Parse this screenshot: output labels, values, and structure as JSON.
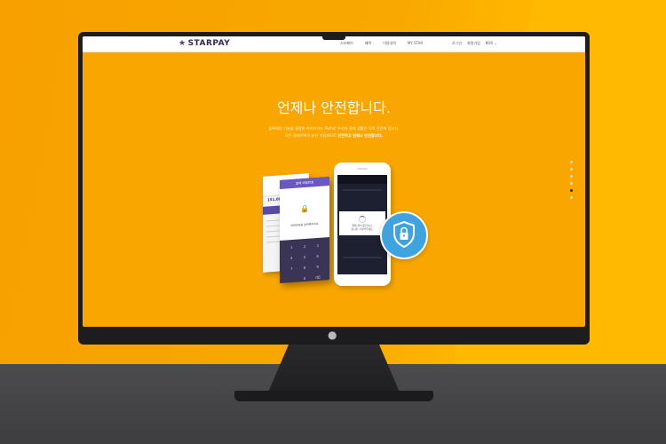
{
  "brand": {
    "name": "STARPAY"
  },
  "nav": {
    "menu": [
      "스타페이",
      "혜택",
      "이용내역",
      "MY STAR"
    ],
    "right": [
      "로그인",
      "회원가입",
      "KOR ⌄"
    ]
  },
  "hero": {
    "title": "언제나 안전합니다.",
    "desc_line1": "블록체인 기술을 결합한 하이브리드 Tech로 우리의 결제 생활은 더욱 안전해 집니다.",
    "desc_line2_plain": "모든 결제기록이 분산 저장되므로",
    "desc_line2_bold": "안전하고 언제나 안전합니다."
  },
  "phone_popup": {
    "text_line1": "결제 처리 중입니다.",
    "text_line2": "잠시만 기다려주세요."
  },
  "card_purple": {
    "header": "결제 비밀번호",
    "panel_text": "비밀번호를 입력해주세요",
    "keys": [
      "1",
      "2",
      "3",
      "4",
      "5",
      "6",
      "7",
      "8",
      "9",
      "",
      "0",
      "⌫"
    ]
  },
  "card_white": {
    "amount": "151,000원"
  },
  "pager": {
    "count": 6,
    "active_index": 5
  },
  "monitor": {
    "chin_logo": ""
  },
  "colors": {
    "accent": "#f9a700",
    "purple": "#5a4aa8",
    "shield": "#3fa3e0"
  }
}
